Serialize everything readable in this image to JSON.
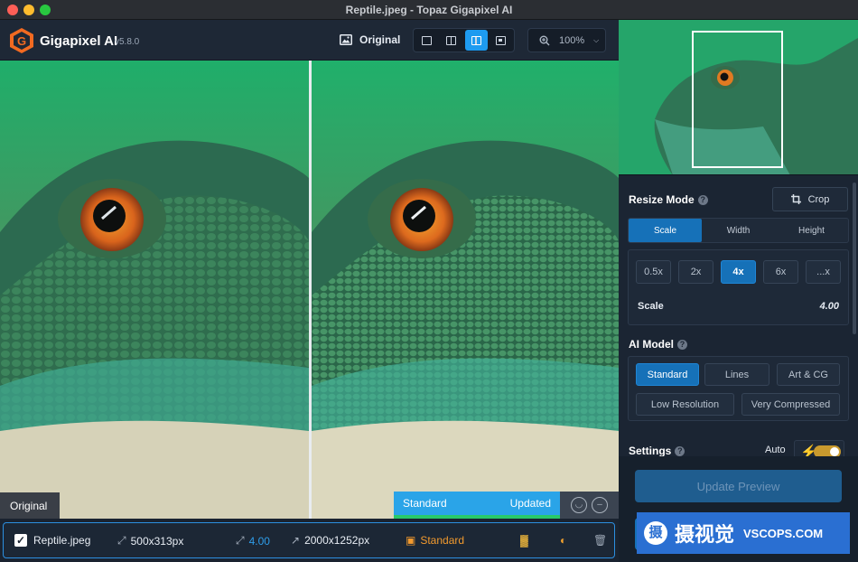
{
  "window": {
    "title": "Reptile.jpeg - Topaz Gigapixel AI"
  },
  "header": {
    "brand": "Gigapixel AI",
    "version": "v5.8.0",
    "original_label": "Original",
    "zoom": "100%"
  },
  "viewer": {
    "original_tag": "Original",
    "status_model": "Standard",
    "status_state": "Updated"
  },
  "file": {
    "name": "Reptile.jpeg",
    "input_size": "500x313px",
    "scale": "4.00",
    "output_size": "2000x1252px",
    "model": "Standard"
  },
  "panel": {
    "resize_mode_label": "Resize Mode",
    "crop_label": "Crop",
    "mode_tabs": [
      {
        "label": "Scale",
        "active": true
      },
      {
        "label": "Width",
        "active": false
      },
      {
        "label": "Height",
        "active": false
      }
    ],
    "scale_options": [
      {
        "label": "0.5x",
        "active": false
      },
      {
        "label": "2x",
        "active": false
      },
      {
        "label": "4x",
        "active": true
      },
      {
        "label": "6x",
        "active": false
      },
      {
        "label": "...x",
        "active": false
      }
    ],
    "scale_label": "Scale",
    "scale_value": "4.00",
    "ai_model_label": "AI Model",
    "models": [
      {
        "label": "Standard",
        "active": true
      },
      {
        "label": "Lines",
        "active": false
      },
      {
        "label": "Art & CG",
        "active": false
      },
      {
        "label": "Low Resolution",
        "active": false
      },
      {
        "label": "Very Compressed",
        "active": false
      }
    ],
    "settings_label": "Settings",
    "auto_label": "Auto",
    "auto_enabled": true,
    "update_label": "Update Preview"
  },
  "watermark": {
    "cn": "摄视觉",
    "en": "VSCOPS.COM",
    "logo": "摄"
  },
  "colors": {
    "accent": "#1671b8",
    "highlight": "#2aa4e8",
    "updated": "#28c96a",
    "model": "#f29a2e"
  }
}
